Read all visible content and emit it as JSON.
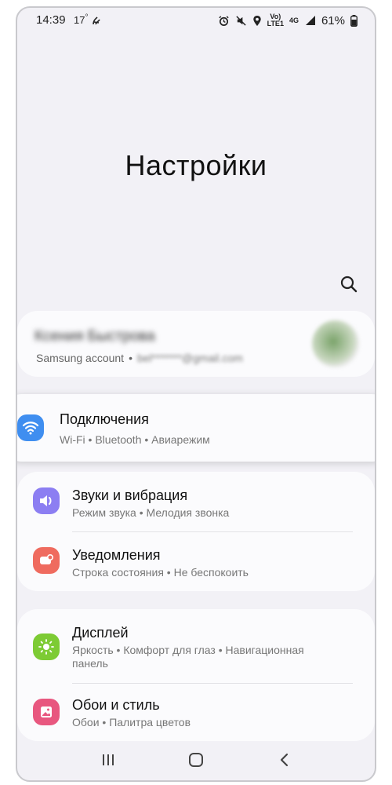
{
  "status_bar": {
    "time": "14:39",
    "temp": "17",
    "battery": "61%",
    "network_top": "Vo)",
    "network_bottom": "LTE1",
    "gen": "4G"
  },
  "page_title": "Настройки",
  "account": {
    "name": "Ксения Быстрова",
    "label": "Samsung account",
    "email": "bel*******@gmail.com"
  },
  "items": [
    {
      "label": "Подключения",
      "desc": "Wi-Fi • Bluetooth • Авиарежим",
      "color": "#3f8ef0"
    },
    {
      "label": "Звуки и вибрация",
      "desc": "Режим звука • Мелодия звонка",
      "color": "#8c7ef2"
    },
    {
      "label": "Уведомления",
      "desc": "Строка состояния • Не беспокоить",
      "color": "#ef6b5f"
    },
    {
      "label": "Дисплей",
      "desc": "Яркость • Комфорт для глаз • Навигационная панель",
      "color": "#7dcb34"
    },
    {
      "label": "Обои и стиль",
      "desc": "Обои • Палитра цветов",
      "color": "#e8577f"
    }
  ],
  "icons": {
    "search": "search-icon",
    "wifi": "wifi-icon",
    "sound": "speaker-icon",
    "notifications": "notification-icon",
    "display": "sun-icon",
    "wallpaper": "image-icon"
  }
}
